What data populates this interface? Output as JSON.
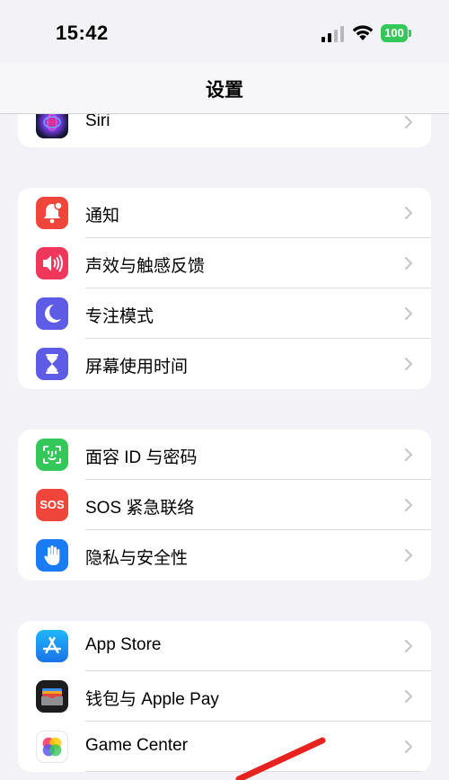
{
  "status_bar": {
    "time": "15:42",
    "battery_percent": "100"
  },
  "nav": {
    "title": "设置"
  },
  "groups": [
    {
      "rows": [
        {
          "label": "Siri",
          "icon": "siri-icon"
        }
      ]
    },
    {
      "rows": [
        {
          "label": "通知",
          "icon": "bell-icon",
          "color": "#f0453a"
        },
        {
          "label": "声效与触感反馈",
          "icon": "speaker-icon",
          "color": "#f0365a"
        },
        {
          "label": "专注模式",
          "icon": "moon-icon",
          "color": "#5e5ce6"
        },
        {
          "label": "屏幕使用时间",
          "icon": "hourglass-icon",
          "color": "#5e5ce6"
        }
      ]
    },
    {
      "rows": [
        {
          "label": "面容 ID 与密码",
          "icon": "faceid-icon",
          "color": "#34c759"
        },
        {
          "label": "SOS 紧急联络",
          "icon": "sos-icon",
          "icon_text": "SOS",
          "color": "#f0453a"
        },
        {
          "label": "隐私与安全性",
          "icon": "hand-icon",
          "color": "#1a7cf5"
        }
      ]
    },
    {
      "rows": [
        {
          "label": "App Store",
          "icon": "appstore-icon",
          "color": "#1b8cf6"
        },
        {
          "label": "钱包与 Apple Pay",
          "icon": "wallet-icon",
          "color": "#1c1c1e"
        },
        {
          "label": "Game Center",
          "icon": "gamecenter-icon",
          "color": "#ffffff"
        }
      ]
    }
  ]
}
